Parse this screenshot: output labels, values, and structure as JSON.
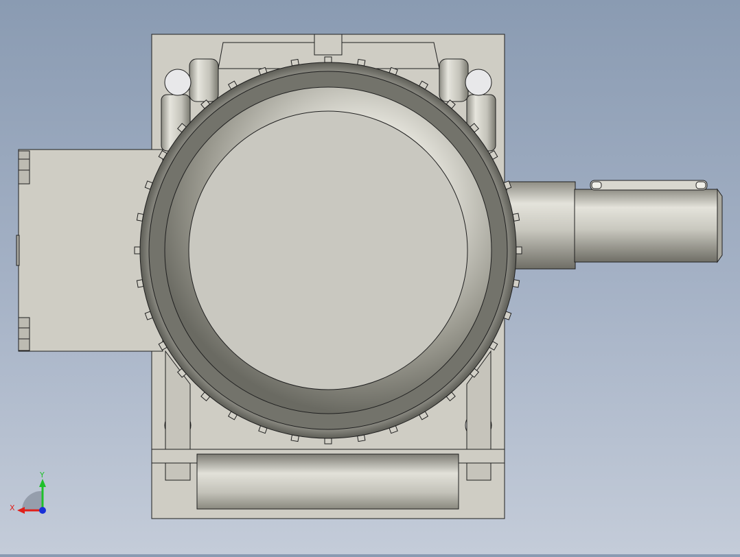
{
  "viewport": {
    "background_top": "#8a9bb2",
    "background_bottom": "#c4ccd9",
    "part_color": "#cfcdc4",
    "edge_color": "#1e1e1e"
  },
  "triad": {
    "x_label": "X",
    "y_label": "Y",
    "x_color": "#e0201a",
    "y_color": "#1fc02a",
    "z_color": "#1830d8"
  }
}
